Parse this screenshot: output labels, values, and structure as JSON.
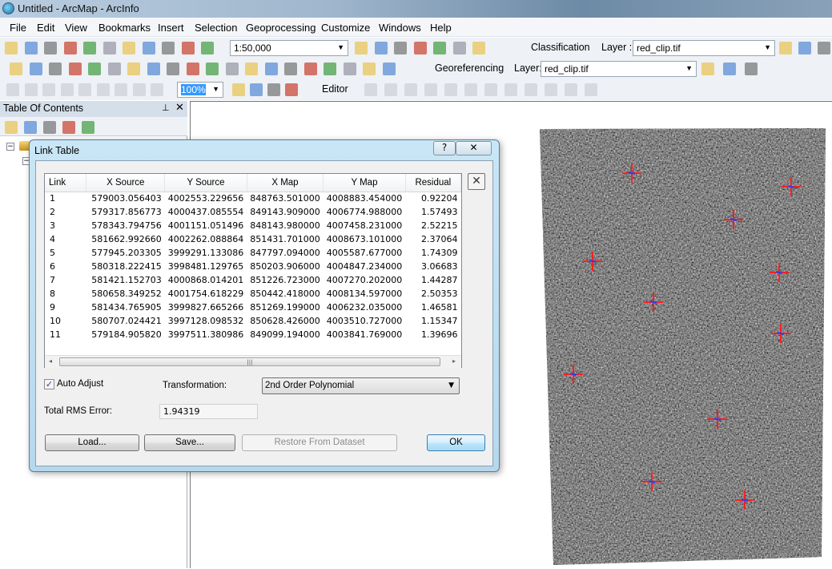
{
  "window": {
    "title": "Untitled - ArcMap - ArcInfo"
  },
  "menu": [
    "File",
    "Edit",
    "View",
    "Bookmarks",
    "Insert",
    "Selection",
    "Geoprocessing",
    "Customize",
    "Windows",
    "Help"
  ],
  "toolbar1": {
    "icons": [
      "new-document-icon",
      "open-folder-icon",
      "save-icon",
      "print-icon",
      "cut-icon",
      "copy-icon",
      "paste-icon",
      "delete-icon",
      "undo-icon",
      "redo-icon",
      "add-data-icon"
    ],
    "scale": "1:50,000",
    "icons2": [
      "editor-toolbar-icon",
      "table-of-contents-icon",
      "catalog-icon",
      "arctoolbox-icon",
      "python-window-icon",
      "model-builder-icon",
      "whats-this-help-icon"
    ],
    "classification_label": "Classification",
    "layer_label": "Layer :",
    "layer_value": "red_clip.tif"
  },
  "toolbar2": {
    "icons": [
      "zoom-in-icon",
      "zoom-out-icon",
      "pan-hand-icon",
      "full-extent-globe-icon",
      "fixed-zoom-in-icon",
      "fixed-zoom-out-icon",
      "back-arrow-icon",
      "forward-arrow-icon",
      "select-features-icon",
      "clear-selection-icon",
      "select-elements-icon",
      "identify-icon",
      "hyperlink-icon",
      "html-popup-icon",
      "measure-icon",
      "find-binoculars-icon",
      "find-route-icon",
      "go-to-xy-icon",
      "time-slider-icon",
      "magnifier-window-icon"
    ],
    "georeferencing_label": "Georeferencing",
    "layer_label": "Layer:",
    "layer_value": "red_clip.tif",
    "icons2": [
      "rotate-icon",
      "add-control-points-icon",
      "view-link-table-icon"
    ]
  },
  "toolbar3": {
    "icons": [
      "layout-zoom-in-icon",
      "layout-zoom-out-icon",
      "layout-pan-icon",
      "zoom-whole-page-icon",
      "zoom-100-icon",
      "fixed-zoom-in-layout-icon",
      "fixed-zoom-out-layout-icon",
      "previous-extent-icon",
      "next-extent-icon"
    ],
    "zoom_percent": "100%",
    "icons2": [
      "toggle-draft-mode-icon",
      "focus-data-frame-icon",
      "change-layout-icon",
      "data-driven-pages-icon"
    ],
    "editor_label": "Editor"
  },
  "toc": {
    "title": "Table Of Contents",
    "tools": [
      "list-by-drawing-order-icon",
      "list-by-source-icon",
      "list-by-visibility-icon",
      "list-by-selection-icon",
      "options-icon"
    ]
  },
  "link_table": {
    "title": "Link Table",
    "help": "?",
    "close": "✕",
    "delete_link": "✕",
    "columns": [
      "Link",
      "X Source",
      "Y Source",
      "X Map",
      "Y Map",
      "Residual"
    ],
    "rows": [
      [
        "1",
        "579003.056403",
        "4002553.229656",
        "848763.501000",
        "4008883.454000",
        "0.92204"
      ],
      [
        "2",
        "579317.856773",
        "4000437.085554",
        "849143.909000",
        "4006774.988000",
        "1.57493"
      ],
      [
        "3",
        "578343.794756",
        "4001151.051496",
        "848143.980000",
        "4007458.231000",
        "2.52215"
      ],
      [
        "4",
        "581662.992660",
        "4002262.088864",
        "851431.701000",
        "4008673.101000",
        "2.37064"
      ],
      [
        "5",
        "577945.203305",
        "3999291.133086",
        "847797.094000",
        "4005587.677000",
        "1.74309"
      ],
      [
        "6",
        "580318.222415",
        "3998481.129765",
        "850203.906000",
        "4004847.234000",
        "3.06683"
      ],
      [
        "7",
        "581421.152703",
        "4000868.014201",
        "851226.723000",
        "4007270.202000",
        "1.44287"
      ],
      [
        "8",
        "580658.349252",
        "4001754.618229",
        "850442.418000",
        "4008134.597000",
        "2.50353"
      ],
      [
        "9",
        "581434.765905",
        "3999827.665266",
        "851269.199000",
        "4006232.035000",
        "1.46581"
      ],
      [
        "10",
        "580707.024421",
        "3997128.098532",
        "850628.426000",
        "4003510.727000",
        "1.15347"
      ],
      [
        "11",
        "579184.905820",
        "3997511.380986",
        "849099.194000",
        "4003841.769000",
        "1.39696"
      ]
    ],
    "auto_adjust_label": "Auto Adjust",
    "auto_adjust_checked": true,
    "transformation_label": "Transformation:",
    "transformation_value": "2nd Order Polynomial",
    "rms_label": "Total RMS Error:",
    "rms_value": "1.94319",
    "buttons": {
      "load": "Load...",
      "save": "Save...",
      "restore": "Restore From Dataset",
      "ok": "OK"
    }
  },
  "colors": {
    "control_point_red": "#ff2020",
    "control_point_blue": "#2040ff",
    "accent": "#3c7fb1"
  }
}
